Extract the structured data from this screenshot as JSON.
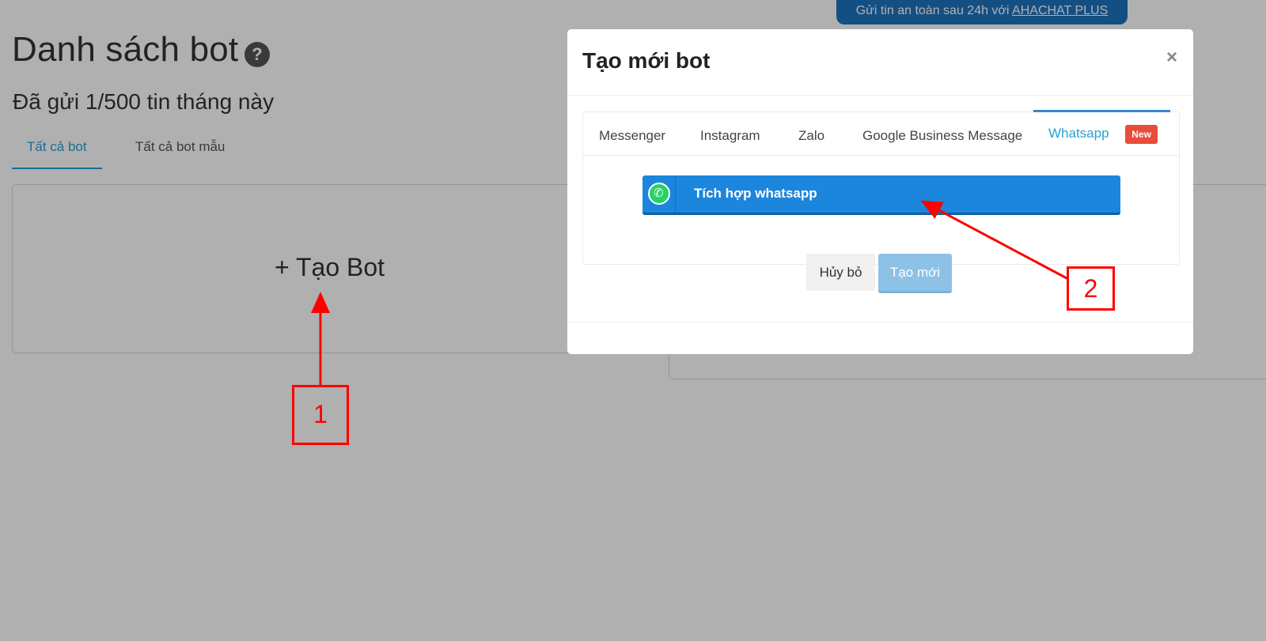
{
  "page": {
    "title": "Danh sách bot",
    "help_icon": "question-circle-icon",
    "subtitle": "Đã gửi 1/500 tin tháng này",
    "tabs": [
      "Tất cả bot",
      "Tất cả bot mẫu"
    ],
    "create_bot_label": "+ Tạo Bot",
    "promo": {
      "text": "Gửi tin an toàn sau 24h với",
      "link": "AHACHAT PLUS"
    }
  },
  "modal": {
    "title": "Tạo mới bot",
    "close_label": "×",
    "channels": [
      "Messenger",
      "Instagram",
      "Zalo",
      "Google Business Message",
      "Whatsapp"
    ],
    "active_channel": "Whatsapp",
    "new_badge": "New",
    "integrate_button": "Tích hợp whatsapp",
    "cancel_button": "Hủy bỏ",
    "create_button": "Tạo mới"
  },
  "annotations": {
    "step1": "1",
    "step2": "2",
    "color": "#ff0000"
  },
  "colors": {
    "accent": "#2a9fd6",
    "primary_button": "#1b86dc",
    "badge": "#e74c3c",
    "banner": "#1e73be"
  }
}
